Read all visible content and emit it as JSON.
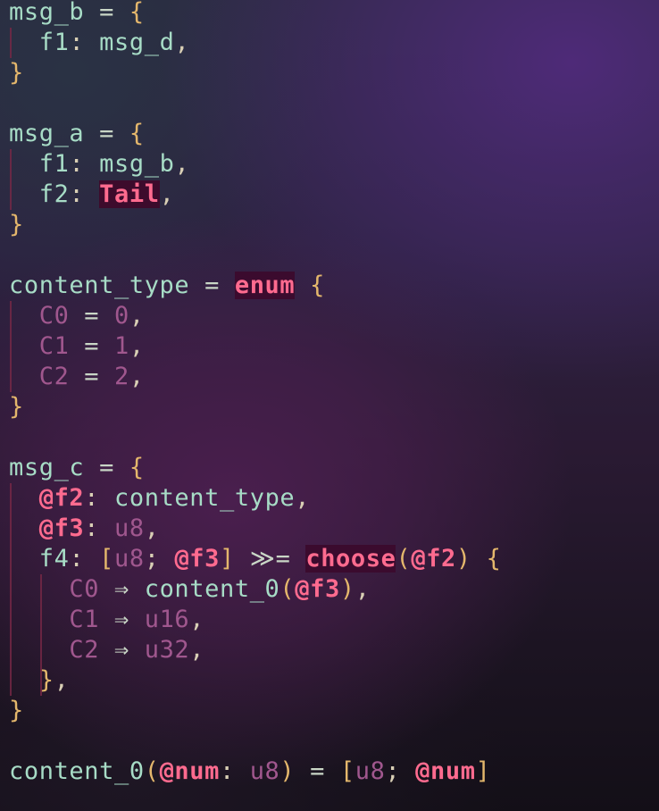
{
  "editor": {
    "lines": [
      [
        {
          "t": "msg_b",
          "c": "ident"
        },
        {
          "t": " = ",
          "c": "op"
        },
        {
          "t": "{",
          "c": "brace"
        }
      ],
      [
        {
          "t": "  "
        },
        {
          "t": "f1",
          "c": "field"
        },
        {
          "t": ": ",
          "c": "punct"
        },
        {
          "t": "msg_d",
          "c": "ident"
        },
        {
          "t": ",",
          "c": "punct"
        }
      ],
      [
        {
          "t": "}",
          "c": "brace"
        }
      ],
      [],
      [
        {
          "t": "msg_a",
          "c": "ident"
        },
        {
          "t": " = ",
          "c": "op"
        },
        {
          "t": "{",
          "c": "brace"
        }
      ],
      [
        {
          "t": "  "
        },
        {
          "t": "f1",
          "c": "field"
        },
        {
          "t": ": ",
          "c": "punct"
        },
        {
          "t": "msg_b",
          "c": "ident"
        },
        {
          "t": ",",
          "c": "punct"
        }
      ],
      [
        {
          "t": "  "
        },
        {
          "t": "f2",
          "c": "field"
        },
        {
          "t": ": ",
          "c": "punct"
        },
        {
          "t": "Tail",
          "c": "tail"
        },
        {
          "t": ",",
          "c": "punct"
        }
      ],
      [
        {
          "t": "}",
          "c": "brace"
        }
      ],
      [],
      [
        {
          "t": "content_type",
          "c": "ident"
        },
        {
          "t": " = ",
          "c": "op"
        },
        {
          "t": "enum",
          "c": "kw kw-bg"
        },
        {
          "t": " "
        },
        {
          "t": "{",
          "c": "brace"
        }
      ],
      [
        {
          "t": "  "
        },
        {
          "t": "C0",
          "c": "variant"
        },
        {
          "t": " = ",
          "c": "op"
        },
        {
          "t": "0",
          "c": "num"
        },
        {
          "t": ",",
          "c": "punct"
        }
      ],
      [
        {
          "t": "  "
        },
        {
          "t": "C1",
          "c": "variant"
        },
        {
          "t": " = ",
          "c": "op"
        },
        {
          "t": "1",
          "c": "num"
        },
        {
          "t": ",",
          "c": "punct"
        }
      ],
      [
        {
          "t": "  "
        },
        {
          "t": "C2",
          "c": "variant"
        },
        {
          "t": " = ",
          "c": "op"
        },
        {
          "t": "2",
          "c": "num"
        },
        {
          "t": ",",
          "c": "punct"
        }
      ],
      [
        {
          "t": "}",
          "c": "brace"
        }
      ],
      [],
      [
        {
          "t": "msg_c",
          "c": "ident"
        },
        {
          "t": " = ",
          "c": "op"
        },
        {
          "t": "{",
          "c": "brace"
        }
      ],
      [
        {
          "t": "  "
        },
        {
          "t": "@f2",
          "c": "ref"
        },
        {
          "t": ": ",
          "c": "punct"
        },
        {
          "t": "content_type",
          "c": "ident"
        },
        {
          "t": ",",
          "c": "punct"
        }
      ],
      [
        {
          "t": "  "
        },
        {
          "t": "@f3",
          "c": "ref"
        },
        {
          "t": ": ",
          "c": "punct"
        },
        {
          "t": "u8",
          "c": "type"
        },
        {
          "t": ",",
          "c": "punct"
        }
      ],
      [
        {
          "t": "  "
        },
        {
          "t": "f4",
          "c": "field"
        },
        {
          "t": ": ",
          "c": "punct"
        },
        {
          "t": "[",
          "c": "brace"
        },
        {
          "t": "u8",
          "c": "type"
        },
        {
          "t": "; ",
          "c": "punct"
        },
        {
          "t": "@f3",
          "c": "ref"
        },
        {
          "t": "]",
          "c": "brace"
        },
        {
          "t": " "
        },
        {
          "t": "≫=",
          "c": "op"
        },
        {
          "t": " "
        },
        {
          "t": "choose",
          "c": "kw kw-bg"
        },
        {
          "t": "(",
          "c": "brace"
        },
        {
          "t": "@f2",
          "c": "ref"
        },
        {
          "t": ")",
          "c": "brace"
        },
        {
          "t": " "
        },
        {
          "t": "{",
          "c": "brace"
        }
      ],
      [
        {
          "t": "    "
        },
        {
          "t": "C0",
          "c": "variant"
        },
        {
          "t": " ⇒ ",
          "c": "op"
        },
        {
          "t": "content_0",
          "c": "ident"
        },
        {
          "t": "(",
          "c": "brace"
        },
        {
          "t": "@f3",
          "c": "ref"
        },
        {
          "t": ")",
          "c": "brace"
        },
        {
          "t": ",",
          "c": "punct"
        }
      ],
      [
        {
          "t": "    "
        },
        {
          "t": "C1",
          "c": "variant"
        },
        {
          "t": " ⇒ ",
          "c": "op"
        },
        {
          "t": "u16",
          "c": "type"
        },
        {
          "t": ",",
          "c": "punct"
        }
      ],
      [
        {
          "t": "    "
        },
        {
          "t": "C2",
          "c": "variant"
        },
        {
          "t": " ⇒ ",
          "c": "op"
        },
        {
          "t": "u32",
          "c": "type"
        },
        {
          "t": ",",
          "c": "punct"
        }
      ],
      [
        {
          "t": "  "
        },
        {
          "t": "}",
          "c": "brace"
        },
        {
          "t": ",",
          "c": "punct"
        }
      ],
      [
        {
          "t": "}",
          "c": "brace"
        }
      ],
      [],
      [
        {
          "t": "content_0",
          "c": "ident"
        },
        {
          "t": "(",
          "c": "brace"
        },
        {
          "t": "@num",
          "c": "ref"
        },
        {
          "t": ": ",
          "c": "punct"
        },
        {
          "t": "u8",
          "c": "type"
        },
        {
          "t": ")",
          "c": "brace"
        },
        {
          "t": " = ",
          "c": "op"
        },
        {
          "t": "[",
          "c": "brace"
        },
        {
          "t": "u8",
          "c": "type"
        },
        {
          "t": "; ",
          "c": "punct"
        },
        {
          "t": "@num",
          "c": "ref"
        },
        {
          "t": "]",
          "c": "brace"
        }
      ]
    ]
  },
  "colors": {
    "identifier": "#a7dcc6",
    "brace": "#e4b76c",
    "type": "#a0578e",
    "keyword": "#ff6b8f",
    "keyword_background": "#3b0b2e"
  }
}
